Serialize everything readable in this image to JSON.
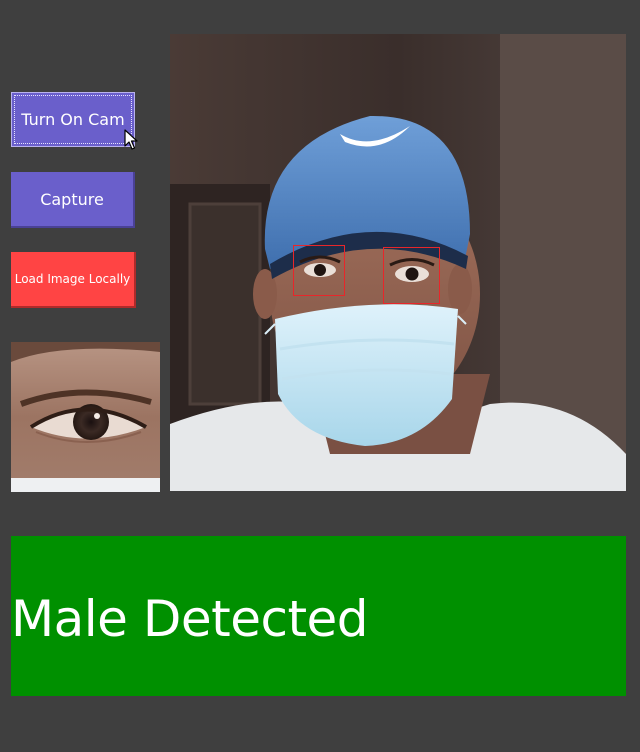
{
  "controls": {
    "turn_on_cam_label": "Turn On Cam",
    "capture_label": "Capture",
    "load_image_label": "Load Image Locally"
  },
  "result": {
    "text": "Male Detected"
  },
  "colors": {
    "background": "#3f3f3f",
    "button_primary": "#6a5fcb",
    "button_danger": "#ff4444",
    "result_success": "#009000",
    "detection_box": "#e8262a"
  },
  "icons": {
    "cursor": "mouse-pointer-icon"
  }
}
